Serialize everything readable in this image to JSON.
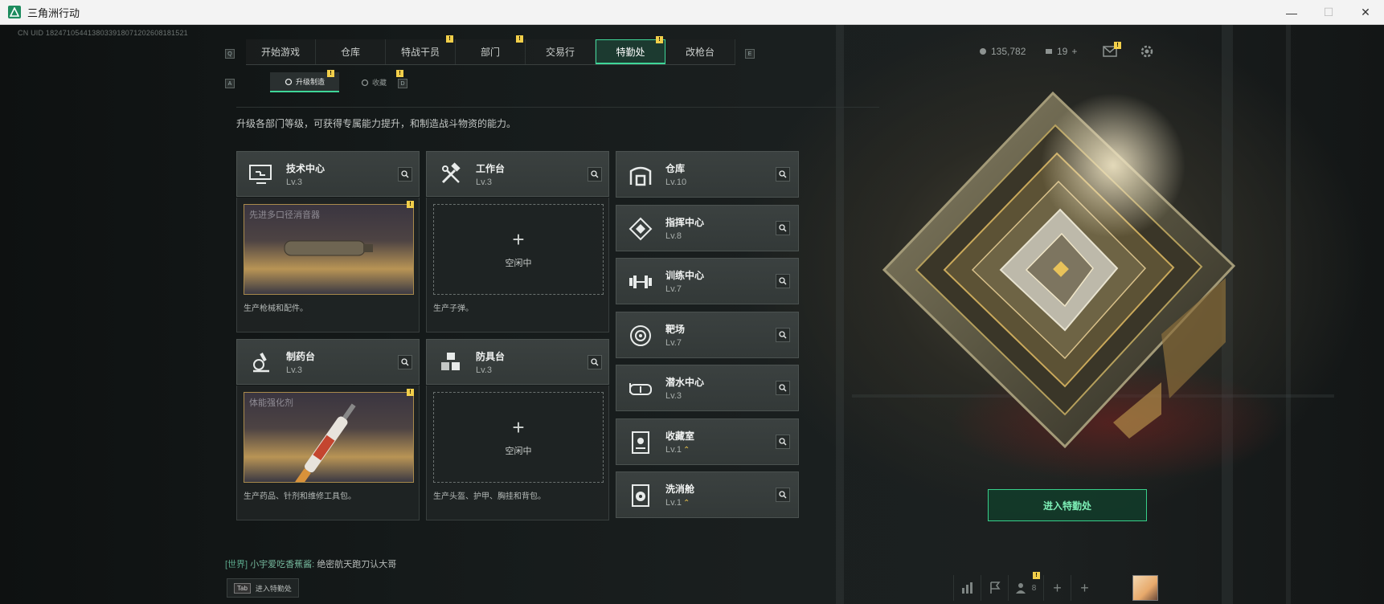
{
  "window": {
    "title": "三角洲行动",
    "minimize": "—",
    "maximize": "☐",
    "close": "✕"
  },
  "uid": "CN UID 1824710544138033918071202608181521",
  "nav": {
    "left_key": "Q",
    "right_key": "E",
    "tabs": [
      {
        "label": "开始游戏",
        "badge": ""
      },
      {
        "label": "仓库",
        "badge": ""
      },
      {
        "label": "特战干员",
        "badge": "!"
      },
      {
        "label": "部门",
        "badge": "!"
      },
      {
        "label": "交易行",
        "badge": ""
      },
      {
        "label": "特勤处",
        "badge": "!",
        "active": true
      },
      {
        "label": "改枪台",
        "badge": ""
      }
    ]
  },
  "subnav": {
    "left_key": "A",
    "right_key": "D",
    "tabs": [
      {
        "label": "升级制造",
        "badge": "!",
        "active": true
      },
      {
        "label": "收藏",
        "badge": "!"
      }
    ]
  },
  "resources": {
    "coins": "135,782",
    "tickets": "19",
    "plus": "+"
  },
  "description": "升级各部门等级，可获得专属能力提升，和制造战斗物资的能力。",
  "cards": [
    {
      "name": "技术中心",
      "level": "Lv.3",
      "icon": "computer-icon",
      "state": "producing",
      "product": "先进多口径消音器",
      "desc": "生产枪械和配件。"
    },
    {
      "name": "工作台",
      "level": "Lv.3",
      "icon": "hammer-wrench-icon",
      "state": "idle",
      "idle_label": "空闲中",
      "desc": "生产子弹。"
    },
    {
      "name": "制药台",
      "level": "Lv.3",
      "icon": "microscope-icon",
      "state": "producing",
      "product": "体能强化剂",
      "desc": "生产药品、针剂和维修工具包。"
    },
    {
      "name": "防具台",
      "level": "Lv.3",
      "icon": "cubes-icon",
      "state": "idle",
      "idle_label": "空闲中",
      "desc": "生产头盔、护甲、胸挂和背包。"
    }
  ],
  "side_cards": [
    {
      "name": "仓库",
      "level": "Lv.10",
      "icon": "warehouse-icon",
      "upgradable": false
    },
    {
      "name": "指挥中心",
      "level": "Lv.8",
      "icon": "command-icon",
      "upgradable": false
    },
    {
      "name": "训练中心",
      "level": "Lv.7",
      "icon": "dumbbell-icon",
      "upgradable": false
    },
    {
      "name": "靶场",
      "level": "Lv.7",
      "icon": "target-icon",
      "upgradable": false
    },
    {
      "name": "潜水中心",
      "level": "Lv.3",
      "icon": "diving-mask-icon",
      "upgradable": false
    },
    {
      "name": "收藏室",
      "level": "Lv.1",
      "icon": "collection-icon",
      "upgradable": true
    },
    {
      "name": "洗消舱",
      "level": "Lv.1",
      "icon": "radiation-icon",
      "upgradable": true
    }
  ],
  "enter_button": "进入特勤处",
  "chat": {
    "channel": "[世界]",
    "user": "小宇爱吃香蕉酱:",
    "message": "绝密航天跑刀认大哥"
  },
  "tab_hint": {
    "key": "Tab",
    "label": "进入特勤处"
  },
  "bottom": {
    "friends_count": "8"
  },
  "colors": {
    "accent": "#3fd698",
    "badge": "#f2cf4a",
    "product_border": "#a98a4c"
  }
}
